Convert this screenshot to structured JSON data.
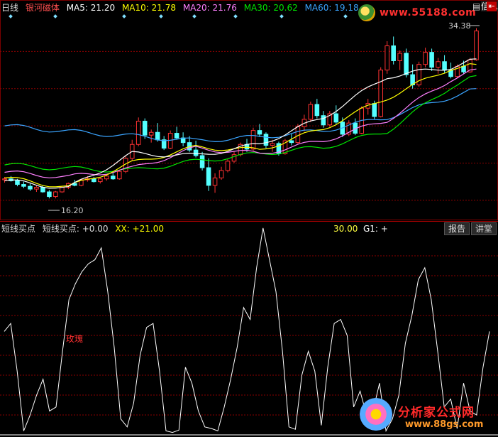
{
  "header": {
    "period": "日线",
    "stock": "银河磁体",
    "ma5": "MA5: 21.20",
    "ma10": "MA10: 21.78",
    "ma20": "MA20: 21.76",
    "ma30": "MA30: 20.62",
    "ma60": "MA60: 19.18",
    "info_label": "信息",
    "watermark_url": "www.55188.com"
  },
  "price_labels": {
    "high": "34.38",
    "low": "16.20"
  },
  "indicator": {
    "name": "短线买点",
    "reading": "短线买点: +0.00",
    "xx": "XX: +21.00",
    "right_value": "30.00",
    "g1": "G1: +",
    "annotation": "玫瑰",
    "tab_report": "报告",
    "tab_lecture": "讲堂"
  },
  "footer_logo": {
    "title": "分析家公式网",
    "url": "www.88gs.com"
  },
  "colors": {
    "bg": "#000000",
    "up": "#ff3232",
    "down": "#54ffff",
    "ma5": "#ffffff",
    "ma10": "#ffff00",
    "ma20": "#ff80ff",
    "ma30": "#00e600",
    "ma60": "#3aa4ff",
    "grid": "#8b0000",
    "stock_name": "#ff5050"
  },
  "chart_data": {
    "type": "line",
    "price_panel": {
      "ylim": [
        14,
        36
      ],
      "grid_values": [
        16,
        20,
        24,
        28,
        32
      ],
      "candles": [
        [
          18.2,
          18.5,
          17.9,
          18.3
        ],
        [
          18.3,
          18.6,
          18.0,
          18.1
        ],
        [
          18.1,
          18.3,
          17.5,
          17.7
        ],
        [
          17.7,
          18.0,
          17.3,
          17.5
        ],
        [
          17.5,
          17.8,
          17.0,
          17.2
        ],
        [
          17.2,
          17.6,
          16.9,
          17.4
        ],
        [
          17.4,
          17.6,
          16.8,
          16.9
        ],
        [
          16.9,
          17.1,
          16.2,
          16.4
        ],
        [
          16.4,
          17.0,
          16.2,
          16.9
        ],
        [
          16.9,
          17.5,
          16.8,
          17.4
        ],
        [
          17.4,
          17.9,
          17.2,
          17.8
        ],
        [
          17.8,
          18.2,
          17.5,
          17.6
        ],
        [
          17.6,
          18.3,
          17.5,
          18.2
        ],
        [
          18.2,
          18.6,
          18.0,
          18.3
        ],
        [
          18.3,
          18.5,
          17.9,
          18.0
        ],
        [
          18.0,
          18.4,
          17.8,
          18.3
        ],
        [
          18.3,
          18.8,
          18.1,
          18.6
        ],
        [
          18.6,
          18.9,
          18.2,
          18.3
        ],
        [
          18.3,
          19.3,
          18.2,
          19.1
        ],
        [
          19.1,
          20.8,
          18.9,
          20.5
        ],
        [
          20.5,
          22.5,
          20.2,
          22.0
        ],
        [
          22.0,
          24.9,
          21.8,
          24.5
        ],
        [
          24.5,
          24.8,
          22.6,
          23.0
        ],
        [
          23.0,
          23.6,
          22.2,
          23.3
        ],
        [
          23.3,
          24.3,
          22.3,
          22.5
        ],
        [
          22.5,
          22.9,
          21.4,
          21.6
        ],
        [
          21.6,
          23.5,
          21.5,
          23.2
        ],
        [
          23.2,
          23.9,
          22.5,
          22.7
        ],
        [
          22.7,
          23.3,
          21.8,
          22.2
        ],
        [
          22.2,
          22.9,
          21.2,
          21.4
        ],
        [
          21.4,
          22.4,
          20.6,
          20.8
        ],
        [
          20.8,
          21.2,
          19.2,
          19.5
        ],
        [
          19.5,
          20.5,
          17.0,
          17.6
        ],
        [
          17.6,
          18.9,
          16.8,
          18.4
        ],
        [
          18.4,
          19.6,
          18.2,
          19.2
        ],
        [
          19.2,
          20.4,
          19.0,
          20.2
        ],
        [
          20.2,
          21.2,
          20.0,
          20.9
        ],
        [
          20.9,
          22.2,
          20.7,
          22.0
        ],
        [
          22.0,
          22.6,
          21.2,
          21.5
        ],
        [
          21.5,
          23.8,
          21.3,
          23.5
        ],
        [
          23.5,
          24.2,
          22.8,
          23.1
        ],
        [
          23.1,
          23.3,
          21.6,
          21.9
        ],
        [
          21.9,
          22.5,
          21.2,
          22.1
        ],
        [
          22.1,
          22.3,
          20.8,
          21.0
        ],
        [
          21.0,
          22.6,
          20.9,
          22.4
        ],
        [
          22.4,
          23.2,
          21.9,
          22.2
        ],
        [
          22.2,
          24.2,
          22.1,
          23.9
        ],
        [
          23.9,
          25.2,
          23.4,
          24.7
        ],
        [
          24.7,
          26.6,
          24.4,
          26.3
        ],
        [
          26.3,
          26.9,
          24.8,
          25.1
        ],
        [
          25.1,
          25.6,
          23.8,
          24.1
        ],
        [
          24.1,
          25.6,
          23.9,
          25.3
        ],
        [
          25.3,
          26.2,
          24.2,
          24.4
        ],
        [
          24.4,
          24.9,
          22.8,
          23.1
        ],
        [
          23.1,
          24.6,
          22.9,
          24.3
        ],
        [
          24.3,
          24.8,
          23.0,
          23.2
        ],
        [
          23.2,
          26.1,
          23.1,
          25.9
        ],
        [
          25.9,
          26.9,
          25.2,
          26.4
        ],
        [
          26.4,
          26.7,
          24.7,
          25.0
        ],
        [
          25.0,
          30.3,
          24.9,
          30.0
        ],
        [
          30.0,
          33.1,
          29.6,
          32.6
        ],
        [
          32.6,
          33.6,
          30.6,
          31.0
        ],
        [
          31.0,
          32.1,
          30.0,
          31.8
        ],
        [
          31.8,
          32.3,
          29.2,
          29.5
        ],
        [
          29.5,
          30.6,
          28.0,
          28.4
        ],
        [
          28.4,
          30.9,
          28.2,
          30.6
        ],
        [
          30.6,
          32.4,
          30.3,
          31.9
        ],
        [
          31.9,
          32.3,
          29.9,
          30.3
        ],
        [
          30.3,
          31.3,
          29.6,
          30.9
        ],
        [
          30.9,
          31.6,
          29.7,
          30.0
        ],
        [
          30.0,
          30.8,
          29.1,
          29.3
        ],
        [
          29.3,
          30.6,
          29.1,
          30.4
        ],
        [
          30.4,
          31.0,
          29.6,
          29.8
        ],
        [
          29.8,
          31.3,
          29.7,
          31.1
        ],
        [
          31.1,
          34.5,
          31.0,
          34.2
        ]
      ],
      "ma60": [
        [
          0,
          24.0
        ],
        [
          10,
          23.4
        ],
        [
          20,
          22.9
        ],
        [
          30,
          22.4
        ],
        [
          40,
          22.8
        ],
        [
          50,
          23.5
        ],
        [
          60,
          24.9
        ],
        [
          70,
          27.1
        ],
        [
          74,
          28.0
        ]
      ],
      "ma30": [
        [
          0,
          19.8
        ],
        [
          10,
          19.4
        ],
        [
          20,
          19.2
        ],
        [
          30,
          20.2
        ],
        [
          40,
          21.0
        ],
        [
          50,
          21.7
        ],
        [
          60,
          23.4
        ],
        [
          70,
          28.2
        ],
        [
          74,
          29.4
        ]
      ],
      "ma20": [
        [
          0,
          19.0
        ],
        [
          10,
          18.5
        ],
        [
          20,
          19.4
        ],
        [
          30,
          21.6
        ],
        [
          40,
          21.0
        ],
        [
          50,
          22.4
        ],
        [
          60,
          24.6
        ],
        [
          70,
          29.0
        ],
        [
          74,
          30.1
        ]
      ],
      "ma10": [
        [
          0,
          18.4
        ],
        [
          10,
          17.4
        ],
        [
          20,
          20.0
        ],
        [
          30,
          21.7
        ],
        [
          40,
          21.4
        ],
        [
          50,
          23.7
        ],
        [
          60,
          27.0
        ],
        [
          70,
          30.2
        ],
        [
          74,
          30.6
        ]
      ],
      "ma5": [
        [
          0,
          18.1
        ],
        [
          10,
          17.3
        ],
        [
          20,
          21.0
        ],
        [
          30,
          20.8
        ],
        [
          40,
          22.0
        ],
        [
          50,
          24.9
        ],
        [
          60,
          29.3
        ],
        [
          70,
          30.3
        ],
        [
          74,
          31.2
        ]
      ]
    },
    "indicator_panel": {
      "ylim": [
        0,
        25
      ],
      "grid_values": [
        2.5,
        5,
        7.5,
        10,
        12.5,
        15,
        17.5,
        20,
        22.5
      ],
      "values": [
        13.0,
        14.0,
        8.0,
        0.5,
        2.5,
        5.0,
        7.0,
        3.0,
        3.5,
        10.5,
        17.0,
        19.0,
        20.5,
        21.5,
        22.0,
        23.5,
        18.0,
        11.0,
        2.0,
        1.0,
        4.0,
        10.0,
        13.5,
        14.0,
        8.0,
        0.5,
        0.3,
        0.6,
        8.5,
        6.5,
        3.0,
        1.0,
        0.8,
        0.5,
        3.5,
        7.0,
        11.0,
        16.0,
        14.5,
        21.0,
        26.0,
        22.0,
        18.0,
        10.5,
        1.0,
        0.7,
        7.5,
        10.5,
        8.0,
        1.2,
        8.5,
        14.0,
        14.5,
        12.5,
        3.5,
        5.5,
        2.5,
        3.0,
        6.5,
        0.5,
        2.0,
        5.0,
        11.5,
        15.0,
        19.5,
        21.0,
        17.0,
        10.5,
        3.5,
        4.5,
        0.8,
        6.5,
        3.0,
        2.5,
        8.5,
        13.0
      ]
    }
  }
}
